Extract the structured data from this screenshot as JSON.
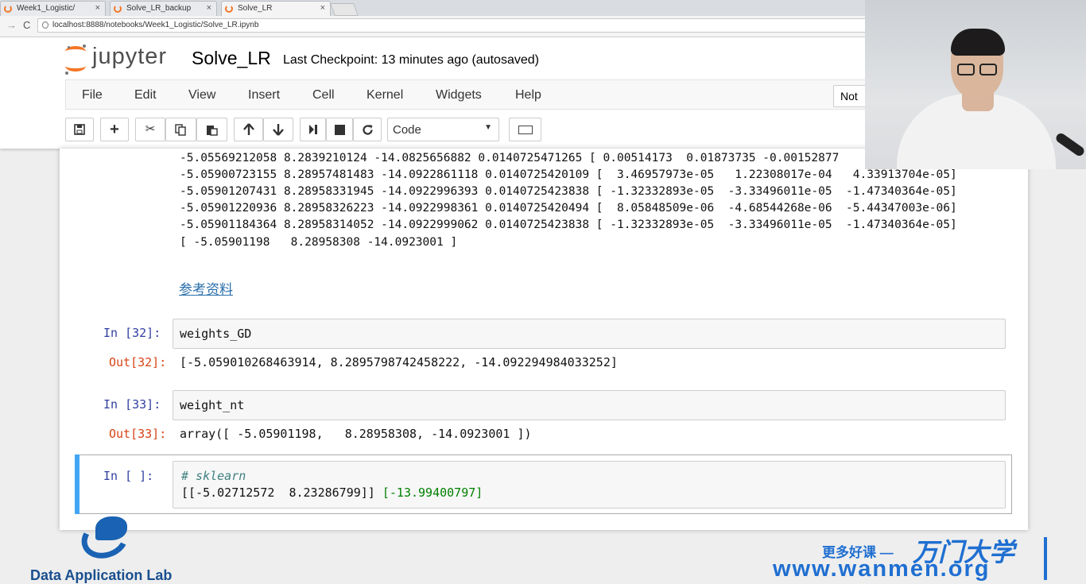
{
  "browser": {
    "tabs": [
      {
        "label": "Week1_Logistic/"
      },
      {
        "label": "Solve_LR_backup"
      },
      {
        "label": "Solve_LR"
      }
    ],
    "close_glyph": "×",
    "url": "localhost:8888/notebooks/Week1_Logistic/Solve_LR.ipynb",
    "back_glyph": "→",
    "reload_glyph": "C"
  },
  "jupyter": {
    "logo_text": "jupyter",
    "notebook_name": "Solve_LR",
    "checkpoint": "Last Checkpoint: 13 minutes ago (autosaved)",
    "menu": [
      "File",
      "Edit",
      "View",
      "Insert",
      "Cell",
      "Kernel",
      "Widgets",
      "Help"
    ],
    "trust_button": "Not",
    "cell_type": "Code"
  },
  "toolbar_icons": [
    "save-icon",
    "plus-icon",
    "cut-icon",
    "copy-icon",
    "paste-icon",
    "arrow-up-icon",
    "arrow-down-icon",
    "step-run-icon",
    "stop-icon",
    "restart-icon",
    "keyboard-icon"
  ],
  "notebook": {
    "prev_output_lines": [
      "-5.05569212058 8.2839210124 -14.0825656882 0.0140725471265 [ 0.00514173  0.01873735 -0.00152877",
      "-5.05900723155 8.28957481483 -14.0922861118 0.0140725420109 [  3.46957973e-05   1.22308017e-04   4.33913704e-05]",
      "-5.05901207431 8.28958331945 -14.0922996393 0.0140725423838 [ -1.32332893e-05  -3.33496011e-05  -1.47340364e-05]",
      "-5.05901220936 8.28958326223 -14.0922998361 0.0140725420494 [  8.05848509e-06  -4.68544268e-06  -5.44347003e-06]",
      "-5.05901184364 8.28958314052 -14.0922999062 0.0140725423838 [ -1.32332893e-05  -3.33496011e-05  -1.47340364e-05]",
      "[ -5.05901198   8.28958308 -14.0923001 ]"
    ],
    "reference_link": "参考资料",
    "cells": [
      {
        "in_prompt": "In [32]:",
        "code": "weights_GD",
        "out_prompt": "Out[32]:",
        "output": "[-5.059010268463914, 8.2895798742458222, -14.092294984033252]"
      },
      {
        "in_prompt": "In [33]:",
        "code": "weight_nt",
        "out_prompt": "Out[33]:",
        "output": "array([ -5.05901198,   8.28958308, -14.0923001 ])"
      }
    ],
    "active_cell": {
      "in_prompt": "In [ ]:",
      "comment": "# sklearn",
      "line_part1": "[[-5.02712572  8.23286799]] ",
      "line_part2": "[-13.99400797]"
    }
  },
  "watermarks": {
    "lab_name": "Data Application Lab",
    "promo_text": "更多好课 —",
    "brand_cn": "万门大学",
    "brand_url": "www.wanmen.org"
  },
  "colors": {
    "jupyter_orange": "#f37726",
    "in_prompt": "#303f9f",
    "out_prompt": "#d84315",
    "selected_cell_bar": "#42a5f5",
    "link": "#296eaa",
    "watermark_blue": "#1f6fd1"
  }
}
